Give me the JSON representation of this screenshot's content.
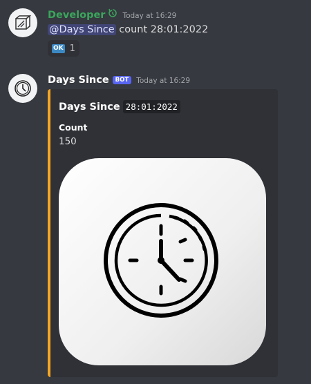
{
  "messages": [
    {
      "username": "Developer",
      "username_color": "#3ba55c",
      "timestamp": "Today at 16:29",
      "mention": "@Days Since",
      "text": "count 28:01:2022",
      "reaction": {
        "emoji": "OK",
        "count": "1"
      }
    },
    {
      "username": "Days Since",
      "username_color": "#ffffff",
      "bot_tag": "BOT",
      "timestamp": "Today at 16:29",
      "embed": {
        "title": "Days Since",
        "title_code": "28:01:2022",
        "accent_color": "#f5a623",
        "field_name": "Count",
        "field_value": "150",
        "image_icon": "clock-icon"
      }
    }
  ]
}
